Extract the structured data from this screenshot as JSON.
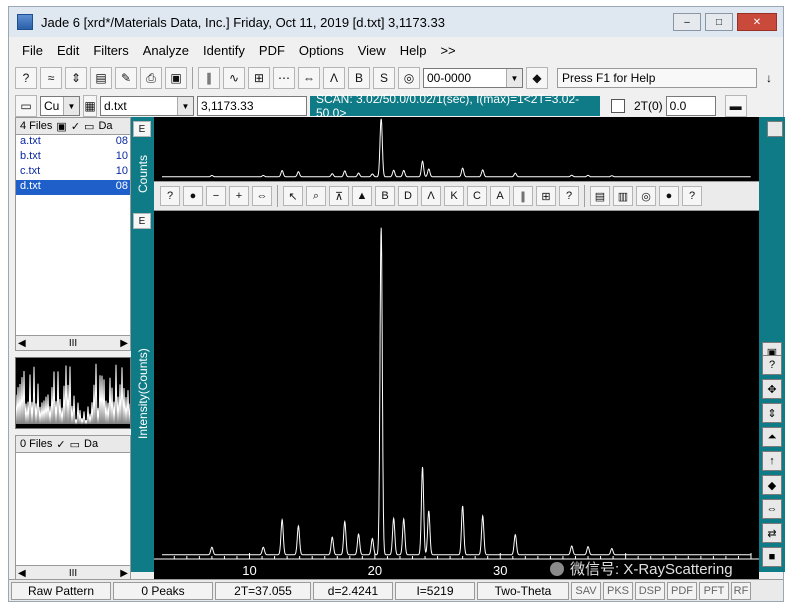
{
  "window": {
    "title": "Jade 6 [xrd*/Materials Data, Inc.] Friday, Oct 11, 2019 [d.txt] 3,1173.33",
    "btn_min": "–",
    "btn_max": "□",
    "btn_close": "✕"
  },
  "menubar": [
    "File",
    "Edit",
    "Filters",
    "Analyze",
    "Identify",
    "PDF",
    "Options",
    "View",
    "Help",
    ">>"
  ],
  "toolbar1": {
    "pdf_combo": "00-0000",
    "help_text": "Press F1 for Help",
    "pin": "↓"
  },
  "toolbar2": {
    "element_combo": "Cu",
    "file_combo": "d.txt",
    "readout": "3,1173.33",
    "scan_text": "SCAN: 3.02/50.0/0.02/1(sec), I(max)=1<2T=3.02-50.0>",
    "two_theta_label": "2T(0)",
    "two_theta_value": "0.0"
  },
  "left_panel": {
    "files_header": "4 Files",
    "files_col2": "Da",
    "files": [
      {
        "name": "a.txt",
        "date": "08"
      },
      {
        "name": "b.txt",
        "date": "10"
      },
      {
        "name": "c.txt",
        "date": "10"
      },
      {
        "name": "d.txt",
        "date": "08"
      }
    ],
    "selected_index": 3,
    "scroll_thumb": "III",
    "files2_header": "0 Files",
    "files2_col2": "Da"
  },
  "plot": {
    "top_axis_label": "Counts",
    "main_axis_label": "Intensity(Counts)",
    "x_ticks": [
      "10",
      "20",
      "30"
    ],
    "side_btn": "E"
  },
  "statusbar": [
    "Raw Pattern",
    "0 Peaks",
    "2T=37.055",
    "d=2.4241",
    "I=5219",
    "Two-Theta",
    "SAV",
    "PKS",
    "DSP",
    "PDF",
    "PFT",
    "RF"
  ],
  "watermark": "微信号: X-RayScattering",
  "chart_data": {
    "type": "line",
    "x_range": [
      3.02,
      50.0
    ],
    "y_range": [
      0,
      5219
    ],
    "xlabel": "",
    "ylabel": "Intensity(Counts)",
    "x_ticks": [
      10,
      20,
      30
    ],
    "peaks": [
      {
        "x": 7.0,
        "y": 120
      },
      {
        "x": 11.1,
        "y": 120
      },
      {
        "x": 12.6,
        "y": 560
      },
      {
        "x": 13.9,
        "y": 460
      },
      {
        "x": 16.6,
        "y": 280
      },
      {
        "x": 17.6,
        "y": 530
      },
      {
        "x": 18.7,
        "y": 330
      },
      {
        "x": 19.8,
        "y": 260
      },
      {
        "x": 20.5,
        "y": 5219
      },
      {
        "x": 21.5,
        "y": 580
      },
      {
        "x": 22.3,
        "y": 570
      },
      {
        "x": 23.8,
        "y": 1400
      },
      {
        "x": 24.3,
        "y": 700
      },
      {
        "x": 27.0,
        "y": 780
      },
      {
        "x": 28.6,
        "y": 620
      },
      {
        "x": 31.2,
        "y": 320
      },
      {
        "x": 35.7,
        "y": 140
      },
      {
        "x": 37.0,
        "y": 130
      },
      {
        "x": 38.9,
        "y": 100
      }
    ]
  }
}
